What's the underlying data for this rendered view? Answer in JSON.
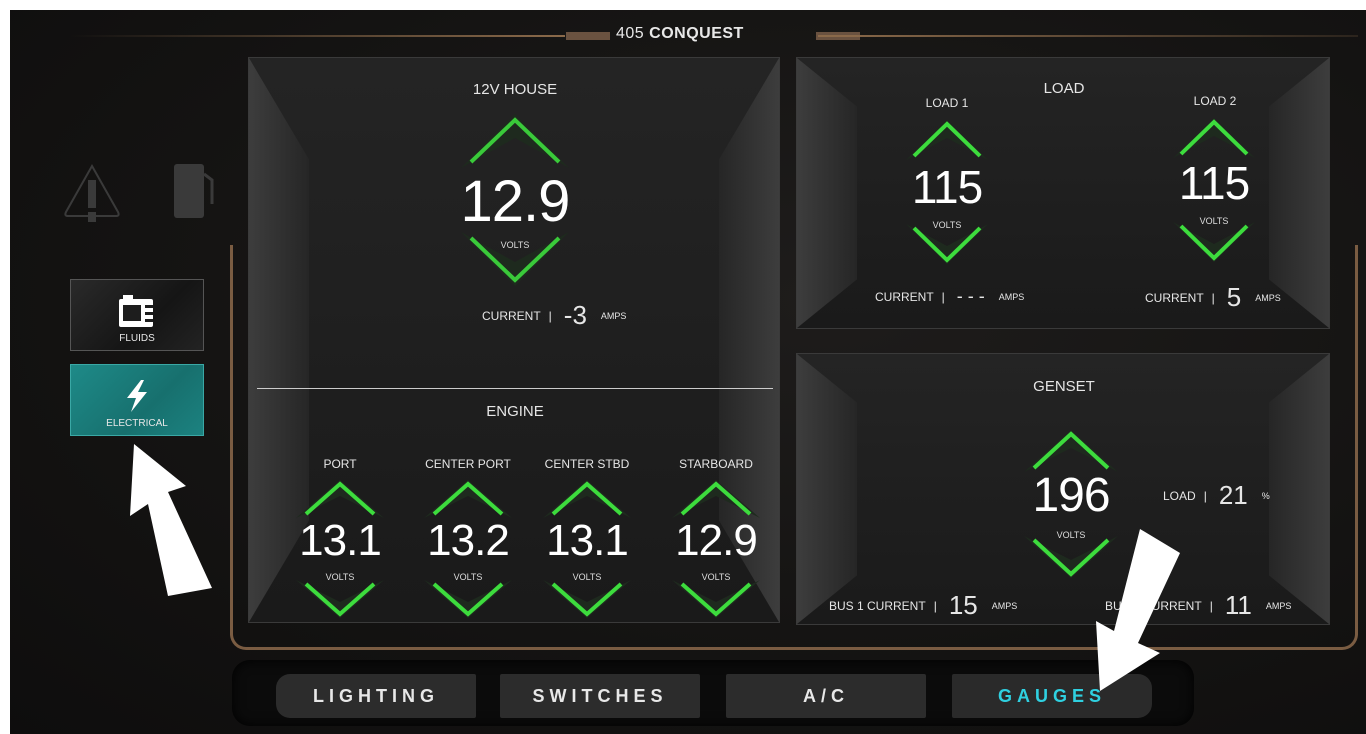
{
  "app": {
    "title_prefix": "405 ",
    "title_bold": "CONQUEST"
  },
  "sidebar": {
    "items": [
      {
        "label": "FLUIDS",
        "icon": "fluid-tank-icon",
        "active": false
      },
      {
        "label": "ELECTRICAL",
        "icon": "lightning-bolt-icon",
        "active": true
      }
    ],
    "status_icons": [
      "warning-icon",
      "fuel-pump-icon"
    ]
  },
  "house": {
    "title": "12V HOUSE",
    "value": "12.9",
    "unit": "VOLTS",
    "current_label": "CURRENT",
    "current_value": "-3",
    "current_unit": "AMPS"
  },
  "engine": {
    "title": "ENGINE",
    "gauges": [
      {
        "label": "PORT",
        "value": "13.1",
        "unit": "VOLTS"
      },
      {
        "label": "CENTER PORT",
        "value": "13.2",
        "unit": "VOLTS"
      },
      {
        "label": "CENTER STBD",
        "value": "13.1",
        "unit": "VOLTS"
      },
      {
        "label": "STARBOARD",
        "value": "12.9",
        "unit": "VOLTS"
      }
    ]
  },
  "load": {
    "title": "LOAD",
    "load1": {
      "label": "LOAD 1",
      "value": "115",
      "unit": "VOLTS",
      "current_label": "CURRENT",
      "current_value": "- - -",
      "current_unit": "AMPS"
    },
    "load2": {
      "label": "LOAD 2",
      "value": "115",
      "unit": "VOLTS",
      "current_label": "CURRENT",
      "current_value": "5",
      "current_unit": "AMPS"
    }
  },
  "genset": {
    "title": "GENSET",
    "value": "196",
    "unit": "VOLTS",
    "load_label": "LOAD",
    "load_value": "21",
    "load_unit": "%",
    "bus1_label": "BUS 1 CURRENT",
    "bus1_value": "15",
    "bus1_unit": "AMPS",
    "bus2_label": "BUS 2 CURRENT",
    "bus2_value": "11",
    "bus2_unit": "AMPS"
  },
  "nav": {
    "tabs": [
      {
        "label": "LIGHTING",
        "active": false
      },
      {
        "label": "SWITCHES",
        "active": false
      },
      {
        "label": "A/C",
        "active": false
      },
      {
        "label": "GAUGES",
        "active": true
      }
    ]
  },
  "colors": {
    "accent_teal": "#1e8a88",
    "active_tab_text": "#2fd0e0",
    "gauge_green": "#3ddc3d",
    "frame_bronze": "#7a5c42"
  }
}
